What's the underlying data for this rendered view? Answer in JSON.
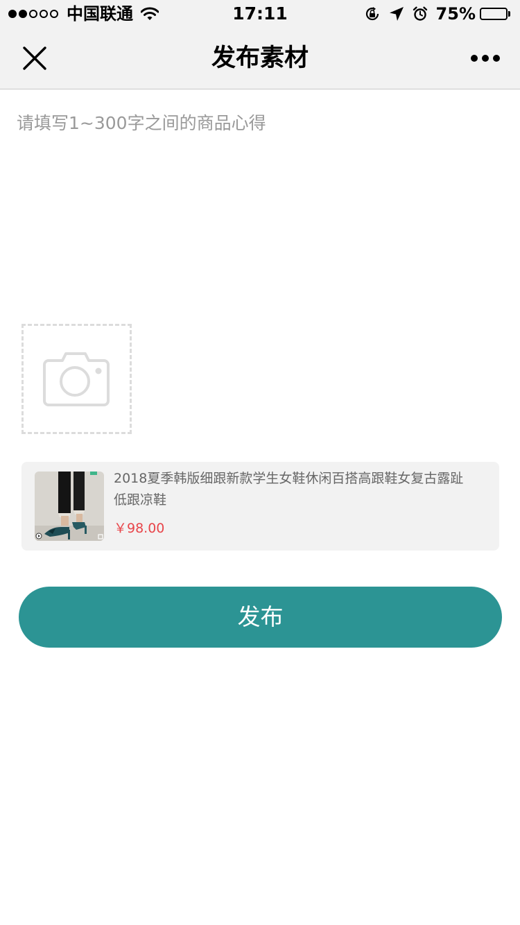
{
  "status_bar": {
    "carrier": "中国联通",
    "time": "17:11",
    "battery_percent": "75%",
    "battery_level": 0.75,
    "icons": [
      "signal-dots-icon",
      "wifi-icon",
      "rotation-lock-icon",
      "location-arrow-icon",
      "alarm-icon",
      "battery-icon"
    ]
  },
  "nav": {
    "title": "发布素材",
    "close_icon": "close-icon",
    "more_icon": "more-icon"
  },
  "editor": {
    "value": "",
    "placeholder": "请填写1~300字之间的商品心得"
  },
  "photo_upload": {
    "icon": "camera-icon"
  },
  "product": {
    "title": "2018夏季韩版细跟新款学生女鞋休闲百搭高跟鞋女复古露趾低跟凉鞋",
    "price": "￥98.00"
  },
  "actions": {
    "publish_label": "发布"
  },
  "colors": {
    "accent": "#2c9494",
    "price": "#e8454a",
    "placeholder": "#999999",
    "bar_background": "#f2f2f2"
  }
}
